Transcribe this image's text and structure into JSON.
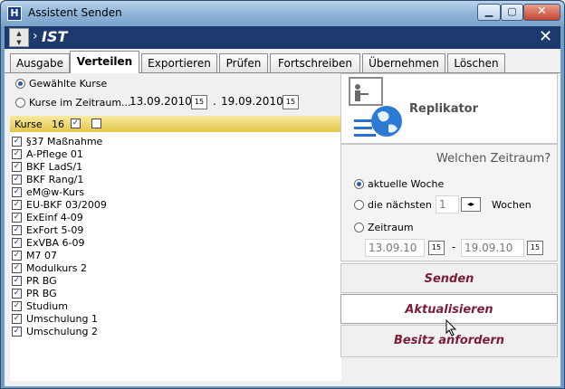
{
  "window": {
    "title": "Assistent Senden",
    "app_icon": "H"
  },
  "header": {
    "title": "IST",
    "close_symbol": "✕"
  },
  "tabs": [
    {
      "label": "Ausgabe"
    },
    {
      "label": "Verteilen"
    },
    {
      "label": "Exportieren"
    },
    {
      "label": "Prüfen"
    },
    {
      "label": "Fortschreiben"
    },
    {
      "label": "Übernehmen"
    },
    {
      "label": "Löschen"
    }
  ],
  "left": {
    "option_selected": "Gewählte Kurse",
    "option_range": "Kurse im Zeitraum...",
    "date_from": "13.09.2010",
    "date_sep": ".",
    "date_to": "19.09.2010",
    "kurse_label": "Kurse",
    "kurse_count": "16",
    "kurse_check": "☑",
    "items": [
      "§37 Maßnahme",
      "A-Pflege 01",
      "BKF LadS/1",
      "BKF Rang/1",
      "eM@w-Kurs",
      "EU-BKF 03/2009",
      "ExEinf 4-09",
      "ExFort 5-09",
      "ExVBA 6-09",
      "M7 07",
      "Modulkurs 2",
      "PR BG",
      "PR BG",
      "Studium",
      "Umschulung 1",
      "Umschulung 2"
    ],
    "check_mark": "✓"
  },
  "right": {
    "title": "Replikator",
    "question": "Welchen Zeitraum?",
    "opt_week": "aktuelle Woche",
    "opt_next": "die nächsten",
    "next_value": "1",
    "weeks_label": "Wochen",
    "opt_range": "Zeitraum",
    "range_from": "13.09.10",
    "range_sep": "-",
    "range_to": "19.09.10",
    "send": "Senden",
    "refresh": "Aktualisieren",
    "ownership": "Besitz anfordern"
  },
  "colors": {
    "header_bg": "#1c3a6d",
    "action_text": "#7b1e38",
    "kurse_bar": "#e4c64a"
  }
}
